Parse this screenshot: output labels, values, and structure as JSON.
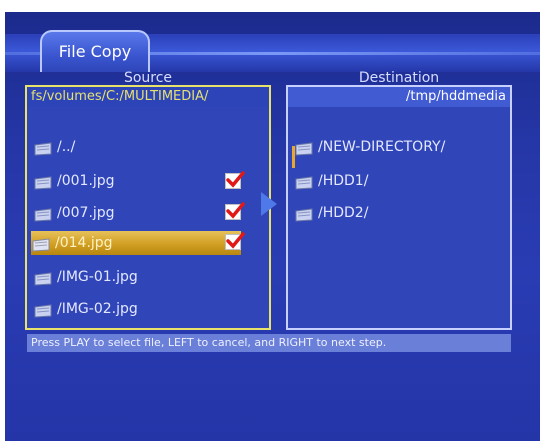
{
  "window": {
    "title": "File Copy"
  },
  "source": {
    "header": "Source",
    "path": "fs/volumes/C:/MULTIMEDIA/",
    "items": [
      {
        "label": "/../",
        "checked": false,
        "selected": false
      },
      {
        "label": "/001.jpg",
        "checked": true,
        "selected": false
      },
      {
        "label": "/007.jpg",
        "checked": true,
        "selected": false
      },
      {
        "label": "/014.jpg",
        "checked": true,
        "selected": true
      },
      {
        "label": "/IMG-01.jpg",
        "checked": false,
        "selected": false
      },
      {
        "label": "/IMG-02.jpg",
        "checked": false,
        "selected": false
      }
    ]
  },
  "destination": {
    "header": "Destination",
    "path": "/tmp/hddmedia",
    "items": [
      {
        "label": "/NEW-DIRECTORY/"
      },
      {
        "label": "/HDD1/"
      },
      {
        "label": "/HDD2/"
      }
    ]
  },
  "status": {
    "hint": "Press PLAY to select file, LEFT to cancel, and RIGHT to next step."
  },
  "colors": {
    "accent": "#e8e16a",
    "selection": "#d19f22",
    "check": "#e01818"
  },
  "icons": {
    "folder": "folder-icon",
    "file": "file-icon",
    "check": "check-icon",
    "arrow": "right-arrow-icon"
  }
}
